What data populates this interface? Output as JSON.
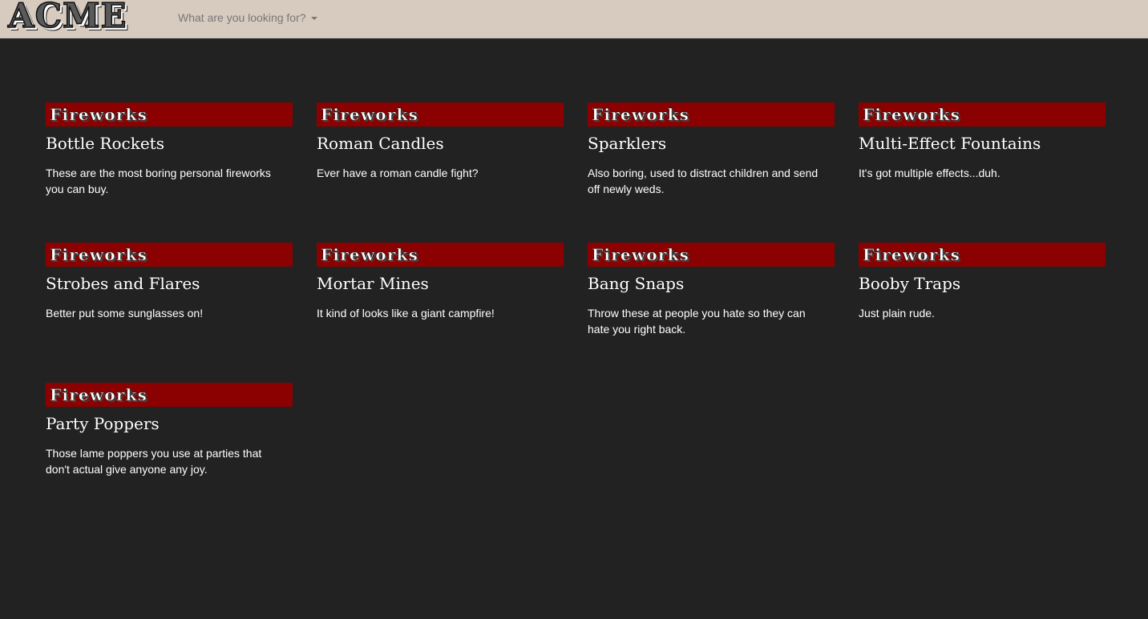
{
  "header": {
    "logo": "ACME",
    "search_dropdown_label": "What are you looking for?"
  },
  "products": [
    {
      "category": "Fireworks",
      "name": "Bottle Rockets",
      "description": "These are the most boring personal fireworks you can buy."
    },
    {
      "category": "Fireworks",
      "name": "Roman Candles",
      "description": "Ever have a roman candle fight?"
    },
    {
      "category": "Fireworks",
      "name": "Sparklers",
      "description": "Also boring, used to distract children and send off newly weds."
    },
    {
      "category": "Fireworks",
      "name": "Multi-Effect Fountains",
      "description": "It's got multiple effects...duh."
    },
    {
      "category": "Fireworks",
      "name": "Strobes and Flares",
      "description": "Better put some sunglasses on!"
    },
    {
      "category": "Fireworks",
      "name": "Mortar Mines",
      "description": "It kind of looks like a giant campfire!"
    },
    {
      "category": "Fireworks",
      "name": "Bang Snaps",
      "description": "Throw these at people you hate so they can hate you right back."
    },
    {
      "category": "Fireworks",
      "name": "Booby Traps",
      "description": "Just plain rude."
    },
    {
      "category": "Fireworks",
      "name": "Party Poppers",
      "description": "Those lame poppers you use at parties that don't actual give anyone any joy."
    }
  ],
  "colors": {
    "navbar_bg": "#d7cbbf",
    "page_bg": "#222222",
    "banner_bg": "#8b0000",
    "text": "#ffffff"
  },
  "icons": {
    "dropdown": "caret-down-icon"
  }
}
